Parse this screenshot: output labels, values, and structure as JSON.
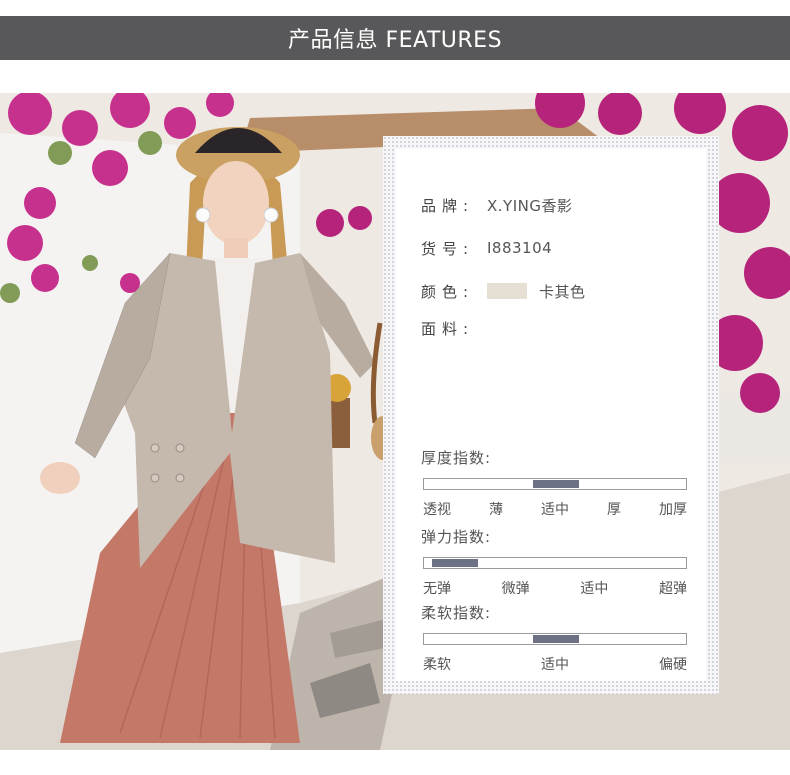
{
  "header": {
    "title": "产品信息 FEATURES"
  },
  "info": {
    "brand": {
      "label": "品牌:",
      "value": "X.YING香影"
    },
    "sku": {
      "label": "货号:",
      "value": "I883104"
    },
    "color": {
      "label": "颜色:",
      "value": "卡其色",
      "swatch": "#e6e0d4"
    },
    "fabric": {
      "label": "面料:",
      "value": ""
    }
  },
  "indices": {
    "thickness": {
      "title": "厚度指数:",
      "levels": [
        "透视",
        "薄",
        "适中",
        "厚",
        "加厚"
      ],
      "selected": "适中"
    },
    "elasticity": {
      "title": "弹力指数:",
      "levels": [
        "无弹",
        "微弹",
        "适中",
        "超弹"
      ],
      "selected": "无弹"
    },
    "softness": {
      "title": "柔软指数:",
      "levels": [
        "柔软",
        "适中",
        "偏硬"
      ],
      "selected": "适中"
    }
  },
  "colors": {
    "header_bg": "#58585a",
    "indicator": "#6d7185",
    "skirt": "#c47868",
    "blazer": "#c4b8ad",
    "flowers": "#c0308a"
  }
}
